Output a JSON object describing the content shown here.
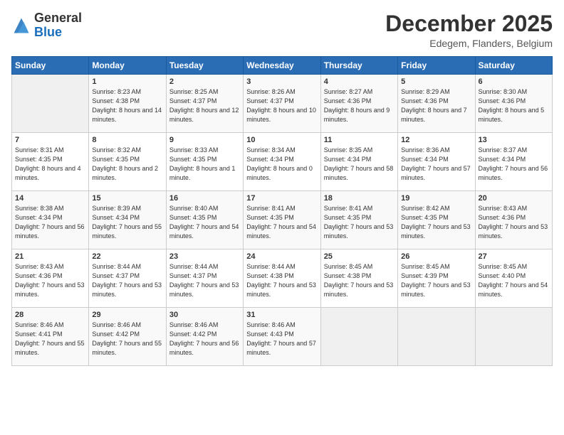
{
  "logo": {
    "general": "General",
    "blue": "Blue"
  },
  "title": "December 2025",
  "location": "Edegem, Flanders, Belgium",
  "days_of_week": [
    "Sunday",
    "Monday",
    "Tuesday",
    "Wednesday",
    "Thursday",
    "Friday",
    "Saturday"
  ],
  "weeks": [
    [
      {
        "day": "",
        "sunrise": "",
        "sunset": "",
        "daylight": ""
      },
      {
        "day": "1",
        "sunrise": "Sunrise: 8:23 AM",
        "sunset": "Sunset: 4:38 PM",
        "daylight": "Daylight: 8 hours and 14 minutes."
      },
      {
        "day": "2",
        "sunrise": "Sunrise: 8:25 AM",
        "sunset": "Sunset: 4:37 PM",
        "daylight": "Daylight: 8 hours and 12 minutes."
      },
      {
        "day": "3",
        "sunrise": "Sunrise: 8:26 AM",
        "sunset": "Sunset: 4:37 PM",
        "daylight": "Daylight: 8 hours and 10 minutes."
      },
      {
        "day": "4",
        "sunrise": "Sunrise: 8:27 AM",
        "sunset": "Sunset: 4:36 PM",
        "daylight": "Daylight: 8 hours and 9 minutes."
      },
      {
        "day": "5",
        "sunrise": "Sunrise: 8:29 AM",
        "sunset": "Sunset: 4:36 PM",
        "daylight": "Daylight: 8 hours and 7 minutes."
      },
      {
        "day": "6",
        "sunrise": "Sunrise: 8:30 AM",
        "sunset": "Sunset: 4:36 PM",
        "daylight": "Daylight: 8 hours and 5 minutes."
      }
    ],
    [
      {
        "day": "7",
        "sunrise": "Sunrise: 8:31 AM",
        "sunset": "Sunset: 4:35 PM",
        "daylight": "Daylight: 8 hours and 4 minutes."
      },
      {
        "day": "8",
        "sunrise": "Sunrise: 8:32 AM",
        "sunset": "Sunset: 4:35 PM",
        "daylight": "Daylight: 8 hours and 2 minutes."
      },
      {
        "day": "9",
        "sunrise": "Sunrise: 8:33 AM",
        "sunset": "Sunset: 4:35 PM",
        "daylight": "Daylight: 8 hours and 1 minute."
      },
      {
        "day": "10",
        "sunrise": "Sunrise: 8:34 AM",
        "sunset": "Sunset: 4:34 PM",
        "daylight": "Daylight: 8 hours and 0 minutes."
      },
      {
        "day": "11",
        "sunrise": "Sunrise: 8:35 AM",
        "sunset": "Sunset: 4:34 PM",
        "daylight": "Daylight: 7 hours and 58 minutes."
      },
      {
        "day": "12",
        "sunrise": "Sunrise: 8:36 AM",
        "sunset": "Sunset: 4:34 PM",
        "daylight": "Daylight: 7 hours and 57 minutes."
      },
      {
        "day": "13",
        "sunrise": "Sunrise: 8:37 AM",
        "sunset": "Sunset: 4:34 PM",
        "daylight": "Daylight: 7 hours and 56 minutes."
      }
    ],
    [
      {
        "day": "14",
        "sunrise": "Sunrise: 8:38 AM",
        "sunset": "Sunset: 4:34 PM",
        "daylight": "Daylight: 7 hours and 56 minutes."
      },
      {
        "day": "15",
        "sunrise": "Sunrise: 8:39 AM",
        "sunset": "Sunset: 4:34 PM",
        "daylight": "Daylight: 7 hours and 55 minutes."
      },
      {
        "day": "16",
        "sunrise": "Sunrise: 8:40 AM",
        "sunset": "Sunset: 4:35 PM",
        "daylight": "Daylight: 7 hours and 54 minutes."
      },
      {
        "day": "17",
        "sunrise": "Sunrise: 8:41 AM",
        "sunset": "Sunset: 4:35 PM",
        "daylight": "Daylight: 7 hours and 54 minutes."
      },
      {
        "day": "18",
        "sunrise": "Sunrise: 8:41 AM",
        "sunset": "Sunset: 4:35 PM",
        "daylight": "Daylight: 7 hours and 53 minutes."
      },
      {
        "day": "19",
        "sunrise": "Sunrise: 8:42 AM",
        "sunset": "Sunset: 4:35 PM",
        "daylight": "Daylight: 7 hours and 53 minutes."
      },
      {
        "day": "20",
        "sunrise": "Sunrise: 8:43 AM",
        "sunset": "Sunset: 4:36 PM",
        "daylight": "Daylight: 7 hours and 53 minutes."
      }
    ],
    [
      {
        "day": "21",
        "sunrise": "Sunrise: 8:43 AM",
        "sunset": "Sunset: 4:36 PM",
        "daylight": "Daylight: 7 hours and 53 minutes."
      },
      {
        "day": "22",
        "sunrise": "Sunrise: 8:44 AM",
        "sunset": "Sunset: 4:37 PM",
        "daylight": "Daylight: 7 hours and 53 minutes."
      },
      {
        "day": "23",
        "sunrise": "Sunrise: 8:44 AM",
        "sunset": "Sunset: 4:37 PM",
        "daylight": "Daylight: 7 hours and 53 minutes."
      },
      {
        "day": "24",
        "sunrise": "Sunrise: 8:44 AM",
        "sunset": "Sunset: 4:38 PM",
        "daylight": "Daylight: 7 hours and 53 minutes."
      },
      {
        "day": "25",
        "sunrise": "Sunrise: 8:45 AM",
        "sunset": "Sunset: 4:38 PM",
        "daylight": "Daylight: 7 hours and 53 minutes."
      },
      {
        "day": "26",
        "sunrise": "Sunrise: 8:45 AM",
        "sunset": "Sunset: 4:39 PM",
        "daylight": "Daylight: 7 hours and 53 minutes."
      },
      {
        "day": "27",
        "sunrise": "Sunrise: 8:45 AM",
        "sunset": "Sunset: 4:40 PM",
        "daylight": "Daylight: 7 hours and 54 minutes."
      }
    ],
    [
      {
        "day": "28",
        "sunrise": "Sunrise: 8:46 AM",
        "sunset": "Sunset: 4:41 PM",
        "daylight": "Daylight: 7 hours and 55 minutes."
      },
      {
        "day": "29",
        "sunrise": "Sunrise: 8:46 AM",
        "sunset": "Sunset: 4:42 PM",
        "daylight": "Daylight: 7 hours and 55 minutes."
      },
      {
        "day": "30",
        "sunrise": "Sunrise: 8:46 AM",
        "sunset": "Sunset: 4:42 PM",
        "daylight": "Daylight: 7 hours and 56 minutes."
      },
      {
        "day": "31",
        "sunrise": "Sunrise: 8:46 AM",
        "sunset": "Sunset: 4:43 PM",
        "daylight": "Daylight: 7 hours and 57 minutes."
      },
      {
        "day": "",
        "sunrise": "",
        "sunset": "",
        "daylight": ""
      },
      {
        "day": "",
        "sunrise": "",
        "sunset": "",
        "daylight": ""
      },
      {
        "day": "",
        "sunrise": "",
        "sunset": "",
        "daylight": ""
      }
    ]
  ]
}
